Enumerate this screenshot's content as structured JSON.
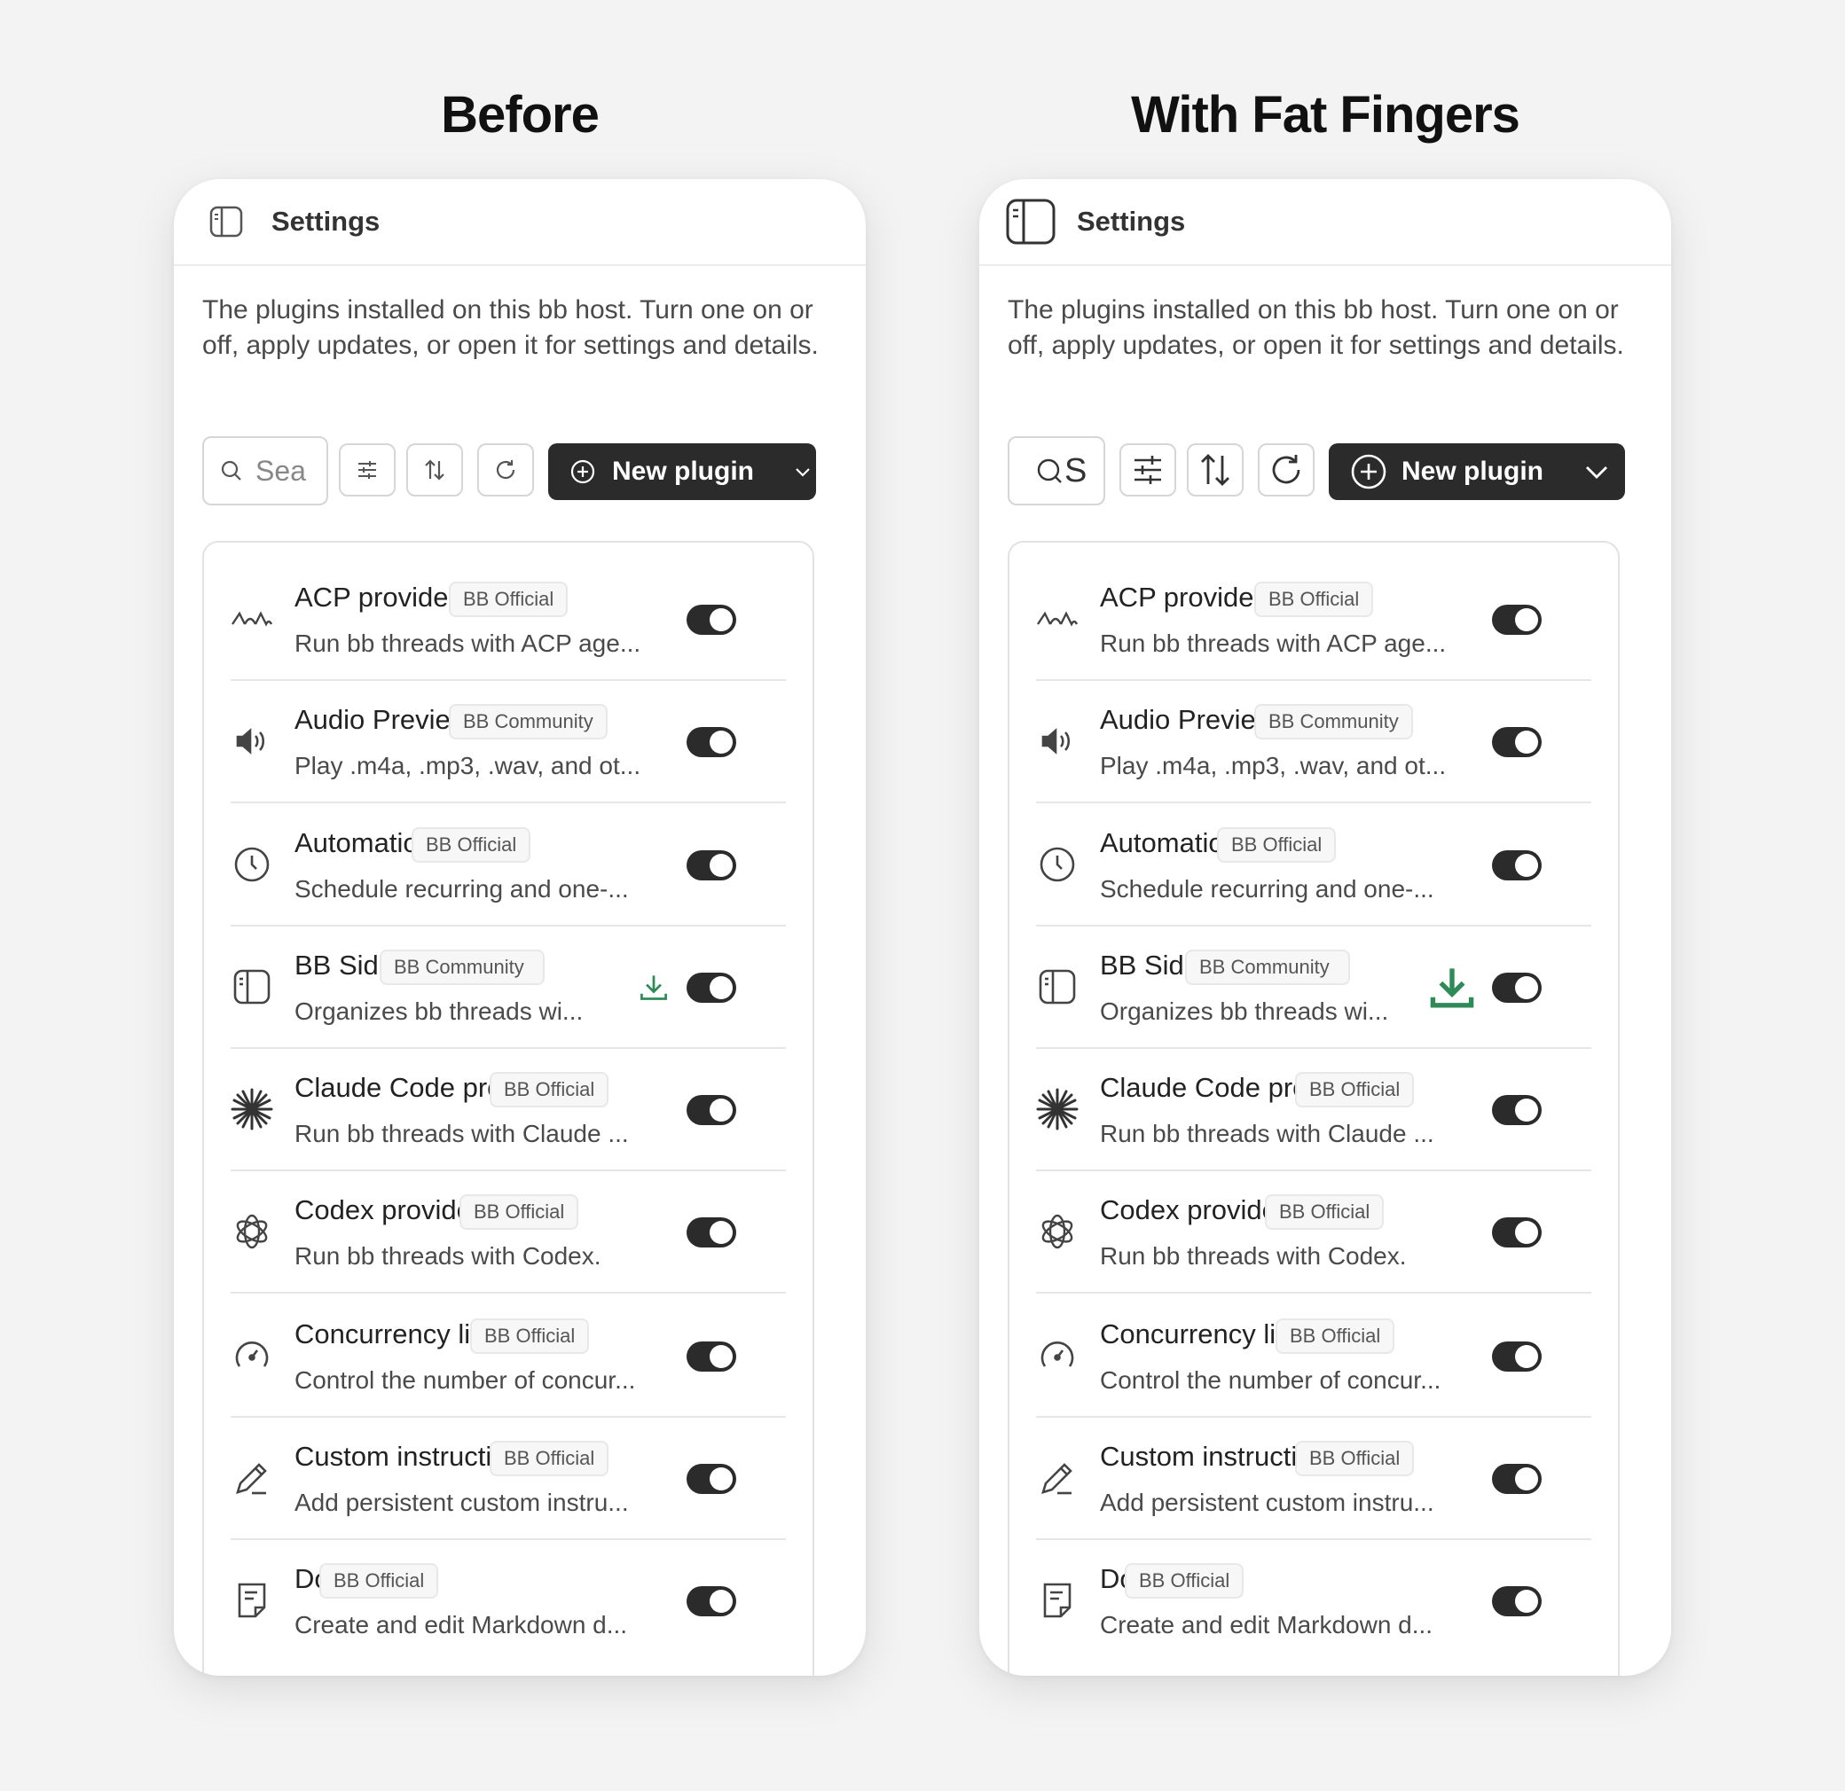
{
  "panels": {
    "before": {
      "title": "Before",
      "header": {
        "title": "Settings"
      },
      "description": "The plugins installed on this bb host. Turn one on or off, apply updates, or open it for settings and details.",
      "toolbar": {
        "search_text": "Sea",
        "new_plugin_label": "New plugin"
      }
    },
    "fat": {
      "title": "With Fat Fingers",
      "header": {
        "title": "Settings"
      },
      "description": "The plugins installed on this bb host. Turn one on or off, apply updates, or open it for settings and details.",
      "toolbar": {
        "search_text": "S",
        "new_plugin_label": "New plugin"
      }
    }
  },
  "plugins": [
    {
      "name": "ACP providers",
      "badge": "BB Official",
      "desc": "Run bb threads with ACP age...",
      "icon": "acp-icon",
      "enabled": true
    },
    {
      "name": "Audio Preview",
      "badge": "BB Community",
      "desc": "Play .m4a, .mp3, .wav, and ot...",
      "icon": "speaker-icon",
      "enabled": true
    },
    {
      "name": "Automations",
      "badge": "BB Official",
      "desc": "Schedule recurring and one-...",
      "icon": "clock-icon",
      "enabled": true
    },
    {
      "name": "BB Side...",
      "badge": "BB Community",
      "desc": "Organizes bb threads wi...",
      "icon": "sidebar-icon",
      "enabled": true,
      "update_available": true
    },
    {
      "name": "Claude Code pro...",
      "badge": "BB Official",
      "desc": "Run bb threads with Claude ...",
      "icon": "asterisk-icon",
      "enabled": true
    },
    {
      "name": "Codex provider",
      "badge": "BB Official",
      "desc": "Run bb threads with Codex.",
      "icon": "openai-icon",
      "enabled": true
    },
    {
      "name": "Concurrency limit",
      "badge": "BB Official",
      "desc": "Control the number of concur...",
      "icon": "gauge-icon",
      "enabled": true
    },
    {
      "name": "Custom instructi...",
      "badge": "BB Official",
      "desc": "Add persistent custom instru...",
      "icon": "pencil-icon",
      "enabled": true
    },
    {
      "name": "Docs",
      "badge": "BB Official",
      "desc": "Create and edit Markdown d...",
      "icon": "document-icon",
      "enabled": true
    }
  ],
  "colors": {
    "accent": "#2b2b2b",
    "download": "#2e8b57",
    "background": "#f3f3f3"
  }
}
